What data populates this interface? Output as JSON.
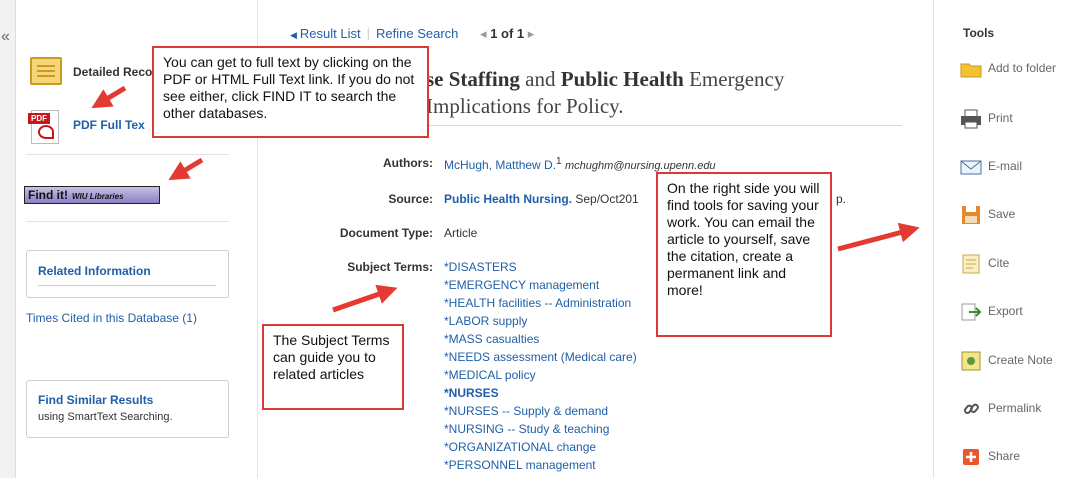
{
  "sidebar": {
    "detailed_record": "Detailed Reco",
    "pdf_full_text": "PDF Full Tex",
    "pdf_tag": "PDF",
    "findit_label": "Find it!",
    "findit_sub": "WIU Libraries",
    "related_information": "Related Information",
    "times_cited": "Times Cited in this Database (1)",
    "find_similar_title": "Find Similar Results",
    "find_similar_sub": "using SmartText Searching."
  },
  "nav": {
    "result_list": "Result List",
    "refine_search": "Refine Search",
    "pager": "1 of 1"
  },
  "record": {
    "title_line1_a": "se Staffing",
    "title_line1_b": " and ",
    "title_line1_c": "Public Health",
    "title_line1_d": " Emergency",
    "title_line2": "Implications for Policy.",
    "authors_label": "Authors:",
    "authors_value": "McHugh, Matthew D.",
    "authors_sup": "1",
    "authors_email": "mchughm@nursing.upenn.edu",
    "source_label": "Source:",
    "source_journal": "Public Health Nursing.",
    "source_date": "Sep/Oct201",
    "source_tail": "p.",
    "doctype_label": "Document Type:",
    "doctype_value": "Article",
    "subject_label": "Subject Terms:",
    "subject_terms": [
      "*DISASTERS",
      "*EMERGENCY management",
      "*HEALTH facilities -- Administration",
      "*LABOR supply",
      "*MASS casualties",
      "*NEEDS assessment (Medical care)",
      "*MEDICAL policy",
      "*NURSES",
      "*NURSES -- Supply & demand",
      "*NURSING -- Study & teaching",
      "*ORGANIZATIONAL change",
      "*PERSONNEL management"
    ]
  },
  "tools": {
    "header": "Tools",
    "items": [
      "Add to folder",
      "Print",
      "E-mail",
      "Save",
      "Cite",
      "Export",
      "Create Note",
      "Permalink",
      "Share"
    ]
  },
  "annotations": {
    "fulltext": "You can get to full text by clicking on the PDF or HTML Full Text link. If you do not see either, click FIND IT to search the other databases.",
    "subject": "The Subject Terms can guide you to related articles",
    "tools": "On the right side you will find tools for saving your work. You can email the article to yourself, save the citation, create a permanent link and more!"
  },
  "colors": {
    "link": "#1f5fa8",
    "annotation": "#d93a34"
  }
}
